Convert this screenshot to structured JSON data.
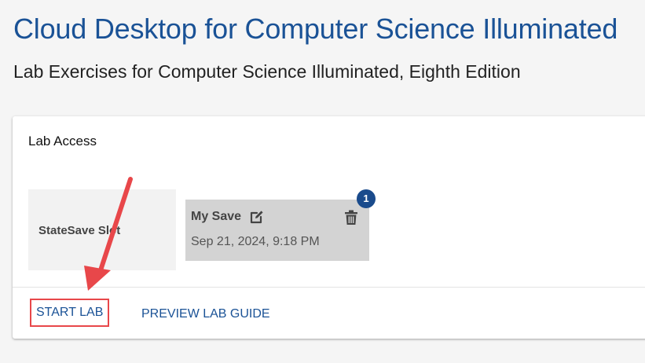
{
  "header": {
    "title": "Cloud Desktop for Computer Science Illuminated",
    "subtitle": "Lab Exercises for Computer Science Illuminated, Eighth Edition"
  },
  "lab_access": {
    "title": "Lab Access",
    "slot": {
      "label": "StateSave Slot"
    },
    "save": {
      "name": "My Save",
      "date": "Sep 21, 2024, 9:18 PM",
      "badge_count": "1",
      "edit_icon": "edit-icon",
      "delete_icon": "trash-icon"
    },
    "actions": {
      "start_label": "START LAB",
      "preview_label": "PREVIEW LAB GUIDE"
    }
  },
  "colors": {
    "title": "#1a5296",
    "badge": "#1a4b8c",
    "highlight": "#e8474a",
    "save_tile": "#d3d3d3",
    "slot_tile": "#f2f2f2"
  }
}
